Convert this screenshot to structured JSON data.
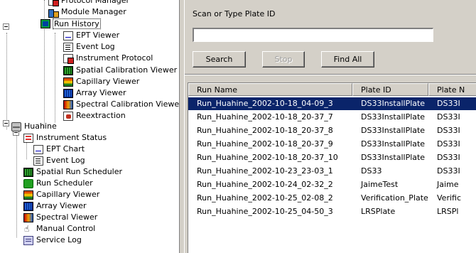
{
  "tree": {
    "items": [
      {
        "label": "Protocol Manager",
        "icon": "protocol-icon"
      },
      {
        "label": "Module Manager",
        "icon": "module-icon"
      },
      {
        "label": "Run History",
        "icon": "run-history-icon"
      },
      {
        "label": "EPT Viewer",
        "icon": "ept-viewer-icon"
      },
      {
        "label": "Event Log",
        "icon": "event-log-icon"
      },
      {
        "label": "Instrument Protocol",
        "icon": "instrument-protocol-icon"
      },
      {
        "label": "Spatial Calibration Viewer",
        "icon": "spatial-calibration-icon"
      },
      {
        "label": "Capillary Viewer",
        "icon": "capillary-icon"
      },
      {
        "label": "Array Viewer",
        "icon": "array-icon"
      },
      {
        "label": "Spectral Calibration Viewer",
        "icon": "spectral-calibration-icon"
      },
      {
        "label": "Reextraction",
        "icon": "reextraction-icon"
      },
      {
        "label": "Huahine",
        "icon": "instrument-icon"
      },
      {
        "label": "Instrument Status",
        "icon": "instrument-status-icon"
      },
      {
        "label": "EPT Chart",
        "icon": "ept-chart-icon"
      },
      {
        "label": "Event Log",
        "icon": "event-log-icon"
      },
      {
        "label": "Spatial Run Scheduler",
        "icon": "spatial-run-scheduler-icon"
      },
      {
        "label": "Run Scheduler",
        "icon": "run-scheduler-icon"
      },
      {
        "label": "Capillary Viewer",
        "icon": "capillary-icon"
      },
      {
        "label": "Array Viewer",
        "icon": "array-icon"
      },
      {
        "label": "Spectral Viewer",
        "icon": "spectral-viewer-icon"
      },
      {
        "label": "Manual Control",
        "icon": "manual-control-icon"
      },
      {
        "label": "Service Log",
        "icon": "service-log-icon"
      }
    ]
  },
  "search": {
    "label": "Scan or Type Plate ID",
    "value": "",
    "placeholder": "",
    "search_button": "Search",
    "stop_button": "Stop",
    "find_all_button": "Find All"
  },
  "table": {
    "columns": [
      "Run Name",
      "Plate ID",
      "Plate N"
    ],
    "rows": [
      [
        "Run_Huahine_2002-10-18_04-09_3",
        "DS33InstallPlate",
        "DS33I"
      ],
      [
        "Run_Huahine_2002-10-18_20-37_7",
        "DS33InstallPlate",
        "DS33I"
      ],
      [
        "Run_Huahine_2002-10-18_20-37_8",
        "DS33InstallPlate",
        "DS33I"
      ],
      [
        "Run_Huahine_2002-10-18_20-37_9",
        "DS33InstallPlate",
        "DS33I"
      ],
      [
        "Run_Huahine_2002-10-18_20-37_10",
        "DS33InstallPlate",
        "DS33I"
      ],
      [
        "Run_Huahine_2002-10-23_23-03_1",
        "DS33",
        "DS33I"
      ],
      [
        "Run_Huahine_2002-10-24_02-32_2",
        "JaimeTest",
        "Jaime"
      ],
      [
        "Run_Huahine_2002-10-25_02-08_2",
        "Verification_Plate",
        "Verific"
      ],
      [
        "Run_Huahine_2002-10-25_04-50_3",
        "LRSPlate",
        "LRSPl"
      ]
    ]
  },
  "colors": {
    "selection": "#0a246a",
    "panel": "#d4d0c8"
  }
}
